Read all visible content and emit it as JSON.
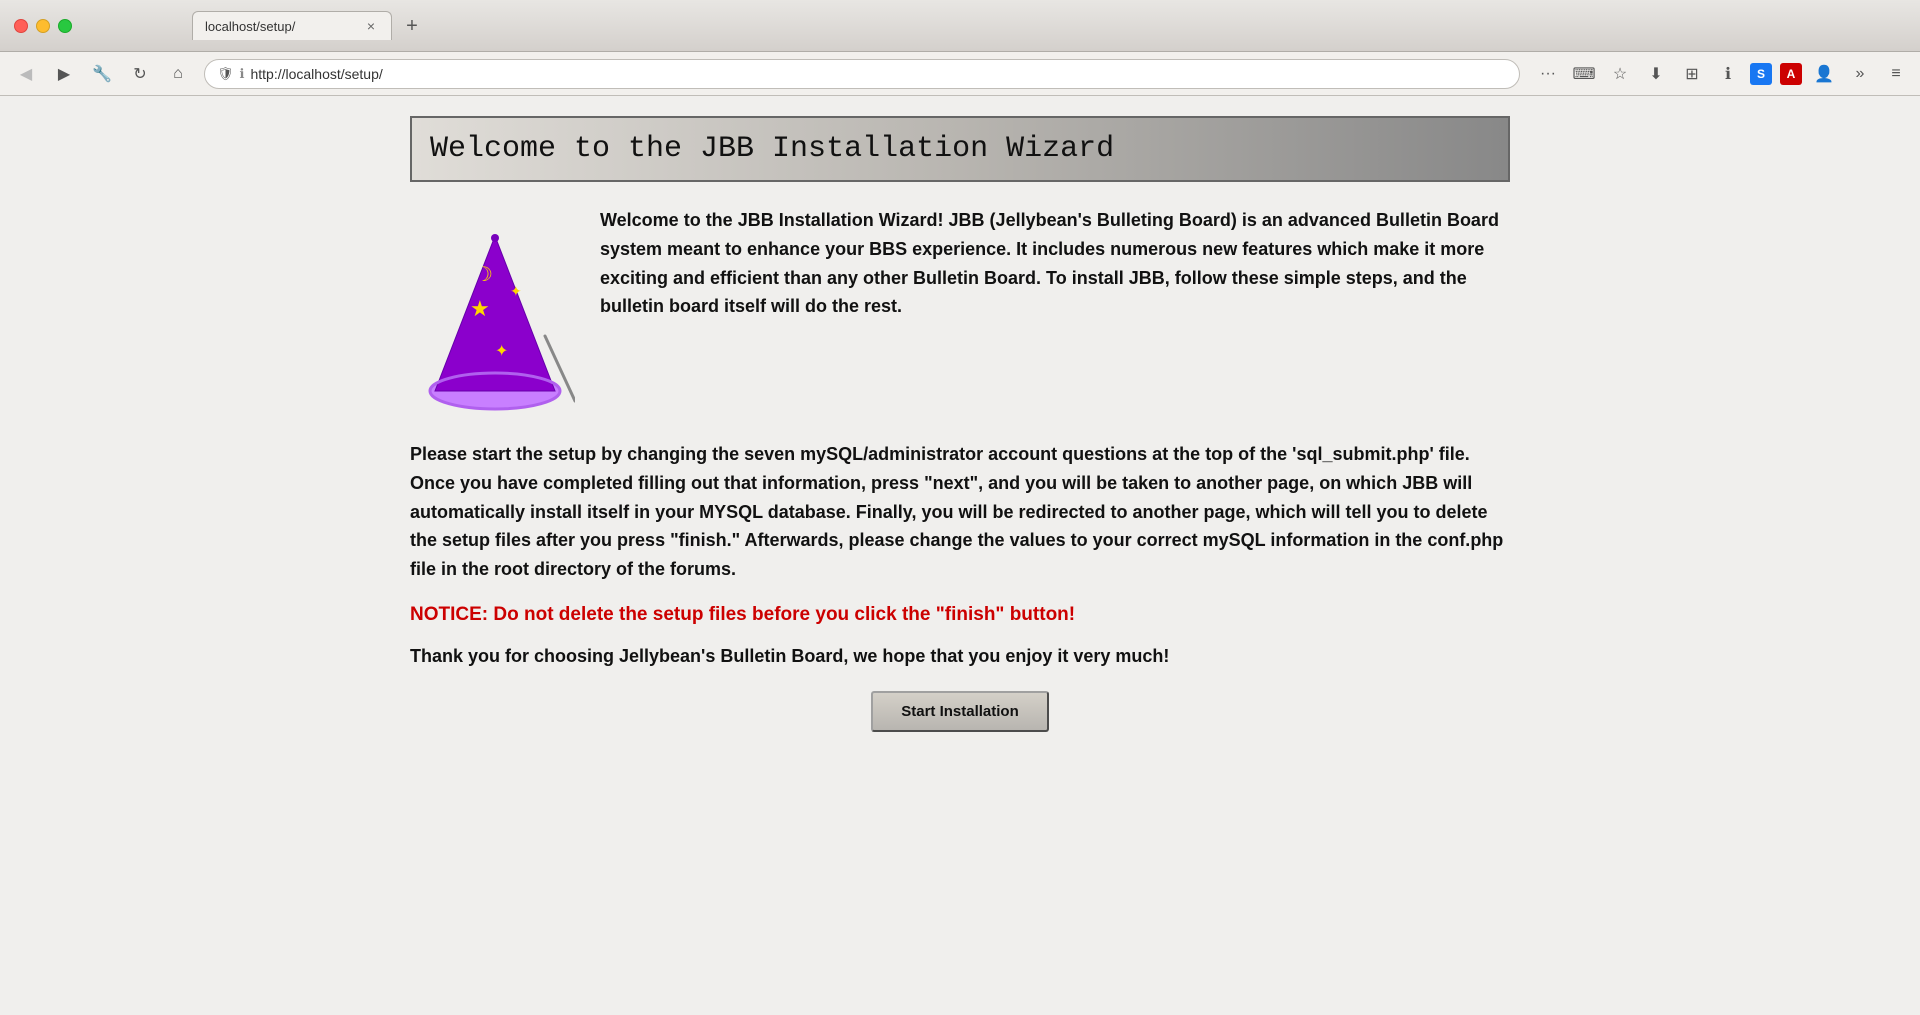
{
  "browser": {
    "tab_title": "localhost/setup/",
    "tab_close": "×",
    "tab_new": "+",
    "nav": {
      "back_label": "←",
      "forward_label": "→",
      "tools_label": "🔧",
      "refresh_label": "↻",
      "home_label": "⌂",
      "address": "http://localhost/setup/",
      "more_label": "···",
      "keyboard_label": "⌨",
      "star_label": "☆",
      "download_label": "↓",
      "extensions_label": "⊞",
      "info_label": "ⓘ",
      "menu_label": "≡"
    }
  },
  "page": {
    "header_title": "Welcome to the JBB Installation Wizard",
    "intro_text": "Welcome to the JBB Installation Wizard! JBB (Jellybean's Bulleting Board) is an advanced Bulletin Board system meant to enhance your BBS experience. It includes numerous new features which make it more exciting and efficient than any other Bulletin Board. To install JBB, follow these simple steps, and the bulletin board itself will do the rest.",
    "main_description": "Please start the setup by changing the seven mySQL/administrator account questions at the top of the 'sql_submit.php' file. Once you have completed filling out that information, press \"next\", and you will be taken to another page, on which JBB will automatically install itself in your MYSQL database. Finally, you will be redirected to another page, which will tell you to delete the setup files after you press \"finish.\" Afterwards, please change the values to your correct mySQL information in the conf.php file in the root directory of the forums.",
    "notice_text": "NOTICE: Do not delete the setup files before you click the \"finish\" button!",
    "thank_you_text": "Thank you for choosing Jellybean's Bulletin Board, we hope that you enjoy it very much!",
    "start_button_label": "Start Installation"
  }
}
